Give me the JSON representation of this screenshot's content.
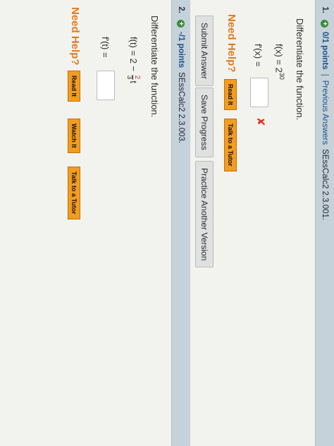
{
  "q1": {
    "number": "1.",
    "points": "0/1 points",
    "separator": "|",
    "prev_link": "Previous Answers",
    "code": "SEssCalc2 2.3.001.",
    "instruction": "Differentiate the function.",
    "function_lhs": "f(x) = 2",
    "function_exponent": "30",
    "answer_label": "f'(x) =",
    "answer_value": "",
    "result_icon": "x-mark-icon",
    "need_help": "Need Help?",
    "read_it": "Read It",
    "talk_tutor": "Talk to a Tutor"
  },
  "actions": {
    "submit": "Submit Answer",
    "save": "Save Progress",
    "practice": "Practice Another Version"
  },
  "q2": {
    "number": "2.",
    "points": "-/1 points",
    "code": "SEssCalc2 2.3.003.",
    "instruction": "Differentiate the function.",
    "function_lhs": "f(t) = 2 −",
    "frac_num": "2",
    "frac_den": "3",
    "function_var": "t",
    "answer_label": "f'(t) =",
    "answer_value": "",
    "need_help": "Need Help?",
    "read_it": "Read It",
    "watch_it": "Watch It",
    "talk_tutor": "Talk to a Tutor"
  },
  "colors": {
    "header_bg": "#c6d2d9",
    "points_link": "#1f4f8a",
    "need_help": "#e07a1f",
    "help_button": "#f39c1f",
    "error_mark": "#dd3322"
  }
}
